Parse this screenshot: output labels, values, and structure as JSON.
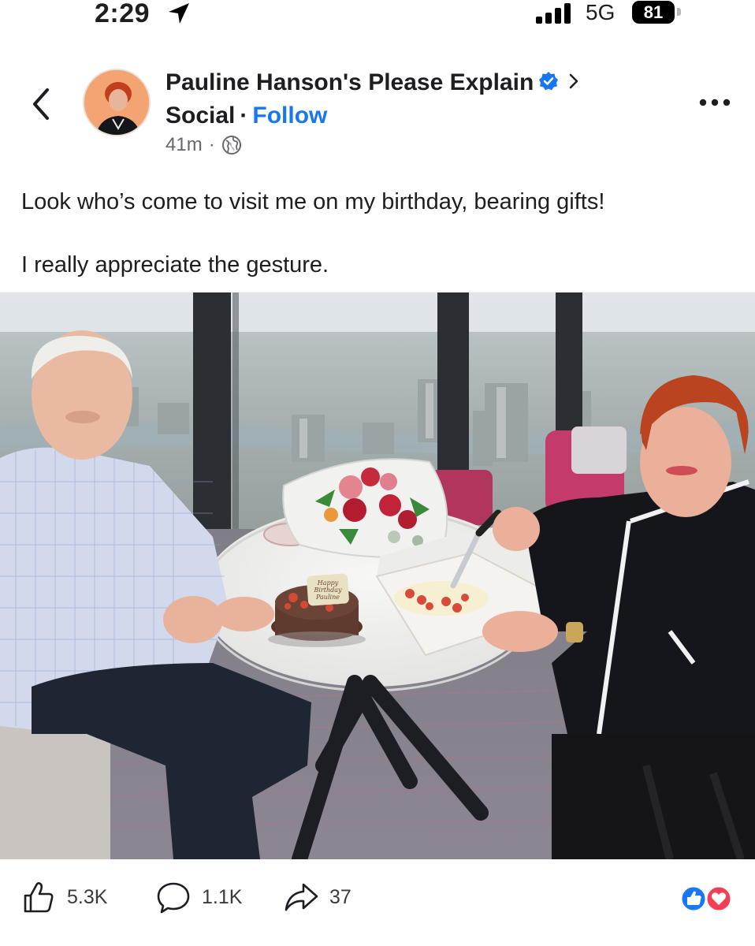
{
  "status_bar": {
    "time": "2:29",
    "network": "5G",
    "battery": "81"
  },
  "post": {
    "page_name_line1": "Pauline Hanson's Please Explain",
    "page_name_line2": "Social",
    "follow_label": "Follow",
    "timestamp": "41m",
    "text_line1": "Look who’s come to visit me on my birthday, bearing gifts!",
    "text_line2": "I really appreciate the gesture.",
    "cake_message": [
      "Happy",
      "Birthday",
      "Pauline"
    ]
  },
  "engagement": {
    "likes": "5.3K",
    "comments": "1.1K",
    "shares": "37"
  },
  "icons": {
    "back": "chevron-left-icon",
    "verified": "verified-badge-icon",
    "chevron": "chevron-right-icon",
    "privacy": "globe-icon",
    "more": "more-options-icon",
    "like": "thumbs-up-icon",
    "comment": "comment-bubble-icon",
    "share": "share-arrow-icon"
  },
  "colors": {
    "accent": "#1877f2",
    "like_reaction": "#1877f2",
    "love_reaction": "#f33e58",
    "meta_text": "#65676b"
  }
}
